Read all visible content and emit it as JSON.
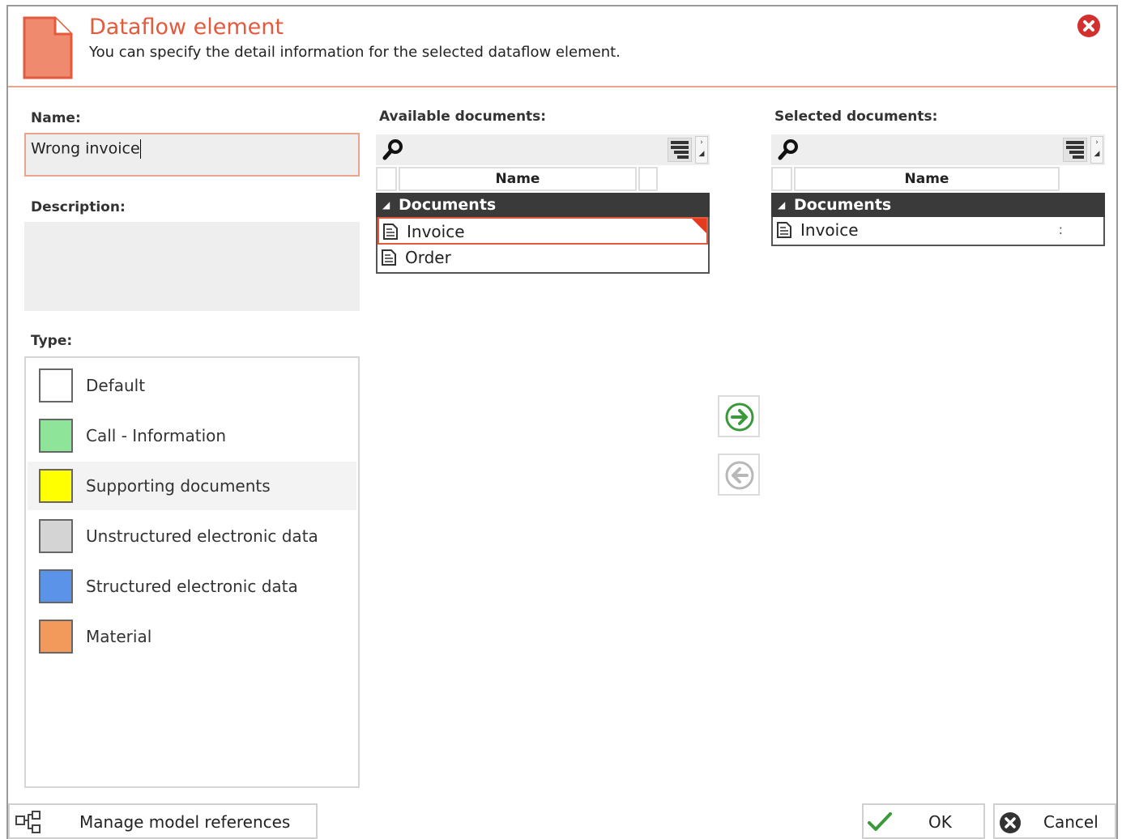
{
  "header": {
    "title": "Dataflow element",
    "subtitle": "You can specify the detail information for the selected dataflow element."
  },
  "form": {
    "name_label": "Name:",
    "name_value": "Wrong invoice",
    "description_label": "Description:",
    "type_label": "Type:"
  },
  "types": [
    {
      "label": "Default",
      "color": "#ffffff",
      "selected": false
    },
    {
      "label": "Call - Information",
      "color": "#8ee59a",
      "selected": false
    },
    {
      "label": "Supporting documents",
      "color": "#ffff00",
      "selected": true
    },
    {
      "label": "Unstructured electronic data",
      "color": "#d4d4d4",
      "selected": false
    },
    {
      "label": "Structured electronic data",
      "color": "#5a93e8",
      "selected": false
    },
    {
      "label": "Material",
      "color": "#f29a5c",
      "selected": false
    }
  ],
  "available": {
    "label": "Available documents:",
    "column": "Name",
    "group": "Documents",
    "items": [
      "Invoice",
      "Order"
    ]
  },
  "selected": {
    "label": "Selected documents:",
    "column": "Name",
    "group": "Documents",
    "items": [
      "Invoice"
    ],
    "row_marker": ":"
  },
  "footer": {
    "manage_label": "Manage model references",
    "ok_label": "OK",
    "cancel_label": "Cancel"
  },
  "colors": {
    "accent": "#e35a3c",
    "group_bg": "#3a3a3a",
    "arrow_green": "#3a9a3a"
  },
  "icons": [
    "document-icon",
    "close-icon",
    "search-icon",
    "filter-icon",
    "arrow-right-icon",
    "arrow-left-icon",
    "model-references-icon",
    "check-icon",
    "cancel-icon"
  ]
}
